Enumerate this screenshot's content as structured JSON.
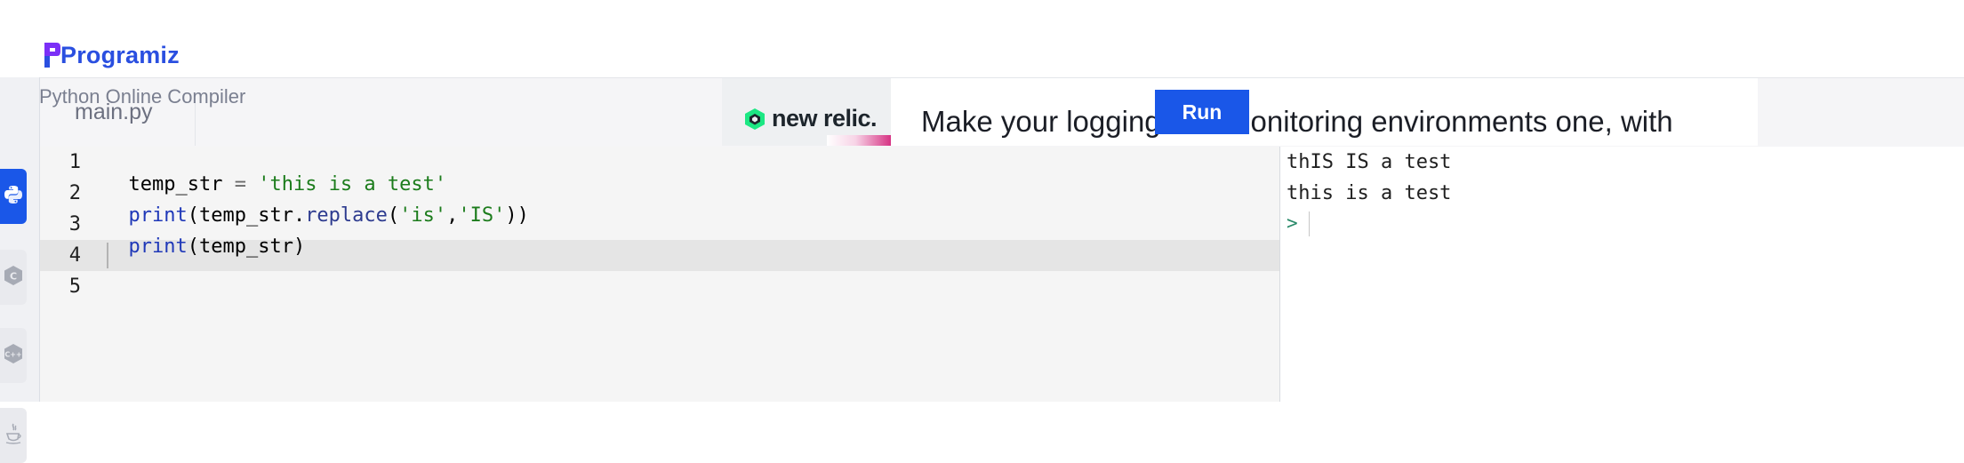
{
  "brand": {
    "name": "Programiz"
  },
  "page": {
    "title": "Python Online Compiler"
  },
  "file": {
    "tab_label": "main.py"
  },
  "toolbar": {
    "run_label": "Run"
  },
  "ad": {
    "brand": "new relic.",
    "headline": "Make your logging and monitoring environments one, with"
  },
  "sidebar": {
    "languages": [
      {
        "icon": "python-icon",
        "active": true
      },
      {
        "icon": "c-icon",
        "active": false
      },
      {
        "icon": "cpp-icon",
        "active": false
      },
      {
        "icon": "java-icon",
        "active": false
      }
    ]
  },
  "editor": {
    "line_numbers": [
      "1",
      "2",
      "3",
      "4",
      "5"
    ],
    "active_line": 4,
    "lines": [
      {
        "tokens": [
          {
            "t": "temp_str",
            "k": "var"
          },
          {
            "t": " = ",
            "k": "op"
          },
          {
            "t": "'this is a test'",
            "k": "str"
          }
        ]
      },
      {
        "tokens": [
          {
            "t": "print",
            "k": "kw"
          },
          {
            "t": "(temp_str.",
            "k": "var"
          },
          {
            "t": "replace",
            "k": "meth"
          },
          {
            "t": "(",
            "k": "var"
          },
          {
            "t": "'is'",
            "k": "str"
          },
          {
            "t": ",",
            "k": "var"
          },
          {
            "t": "'IS'",
            "k": "str"
          },
          {
            "t": "))",
            "k": "var"
          }
        ]
      },
      {
        "tokens": [
          {
            "t": "print",
            "k": "kw"
          },
          {
            "t": "(temp_str)",
            "k": "var"
          }
        ]
      },
      {
        "tokens": []
      },
      {
        "tokens": []
      }
    ]
  },
  "output": {
    "lines": [
      "thIS IS a test",
      "this is a test"
    ],
    "prompt": ">"
  },
  "colors": {
    "accent": "#1a57e8",
    "brand_text": "#2a4fe0",
    "string": "#1c7c1c",
    "keyword": "#1f38b8"
  }
}
